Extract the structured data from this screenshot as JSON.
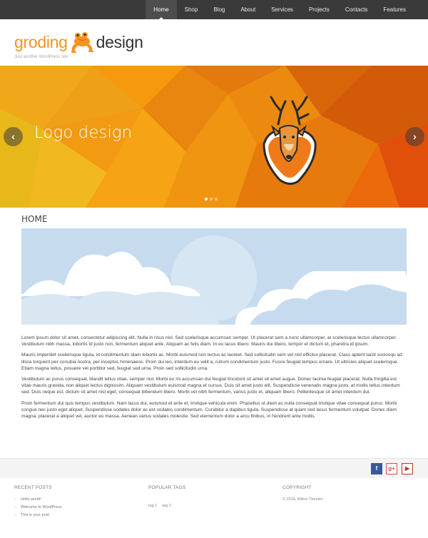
{
  "nav": {
    "items": [
      "Home",
      "Shop",
      "Blog",
      "About",
      "Services",
      "Projects",
      "Contacts",
      "Features"
    ],
    "active": "Home"
  },
  "header": {
    "logo_part1": "groding",
    "logo_part2": "design",
    "tagline": "Just another WordPress site",
    "logo_icon": "frog-icon"
  },
  "slider": {
    "title": "Logo design",
    "prev_icon": "chevron-left-icon",
    "next_icon": "chevron-right-icon",
    "prev_label": "‹",
    "next_label": "›",
    "slide_count": 3,
    "active_slide": 1,
    "image_icon": "deer-head-icon"
  },
  "content": {
    "title": "HOME",
    "paragraphs": [
      "Lorem ipsum dolor sit amet, consectetur adipiscing elit. Nulla in risus nisl. Sed scelerisque accumsan semper. Ut placerat sem a nunc ullamcorper, at scelerisque lectus ullamcorper. Vestibulum nibh massa, lobortis id justo non, fermentum aliquet ante. Aliquam ac felis diam. In eu lacus libero. Mauris dui libero, tempor et dictum et, pharetra id ipsum.",
      "Mauris imperdiet scelerisque ligula, id condimentum diam lobortis ac. Morbi euismod non lectus ac laoreet. Sed sollicitudin sem vel nisl efficitur placerat. Class aptent taciti sociosqu ad litora torquent per conubia nostra, per inceptos himenaeos. Proin dui leo, interdum eu velit a, rutrum condimentum justo. Fusce feugiat tempus ornare. Ut ultricies aliquet scelerisque. Etiam magna tellus, posuere vel porttitor sed, feugiat sed urna. Proin sed sollicitudin urna.",
      "Vestibulum ac purus consequat, blandit tellus vitae, semper nisl. Morbi eu mi accumsan dui feugiat tincidunt sit amet sit amet augue. Donec lacinia feugiat placerat. Nulla fringilla est vitae mauris gravida, non aliquet lectus dignissim. Aliquam vestibulum euismod magna et cursus. Duis sit amet justo elit. Suspendisse venenatis magna justo, at mollis tellus interdum sed. Duis neque est, dictum sit amet nisl eget, consequat bibendum libero. Morbi vel nibh fermentum, varius justo et, aliquam libero. Pellentesque sit amet interdum dui.",
      "Proin fermentum dui quis tempus vestibulum. Nam lacus dui, euismod et ante et, tristique vehicula enim. Phasellus ut diam ac nulla consequat tristique vitae consequat purus. Morbi congue nec justo eget aliquet. Suspendisse sodales dolor ac est sodales condimentum. Curabitur a dapibus ligula. Suspendisse at quam sed lacus fermentum volutpat. Donec diam magna, placerat a aliquet vel, auctor eu massa. Aenean varius sodales molestie. Sed elementum dolor a arcu finibus, in hendrerit ante mollis."
    ]
  },
  "social": {
    "facebook": "f",
    "googleplus": "g+",
    "youtube": "▶",
    "facebook_icon": "facebook-icon",
    "googleplus_icon": "googleplus-icon",
    "youtube_icon": "youtube-icon"
  },
  "footer": {
    "recent_posts": {
      "title": "RECENT POSTS",
      "items": [
        "Hello world!",
        "Welcome to WordPress",
        "This is your post"
      ]
    },
    "popular_tags": {
      "title": "POPULAR TAGS",
      "tags": [
        "tag 1",
        "tag 2"
      ]
    },
    "copyright": {
      "title": "COPYRIGHT",
      "text": "© 2014, Billion Themler"
    }
  },
  "colors": {
    "topbar": "#3a3a3a",
    "accent": "#f7941d",
    "hero_sky": "#c6dcee"
  }
}
